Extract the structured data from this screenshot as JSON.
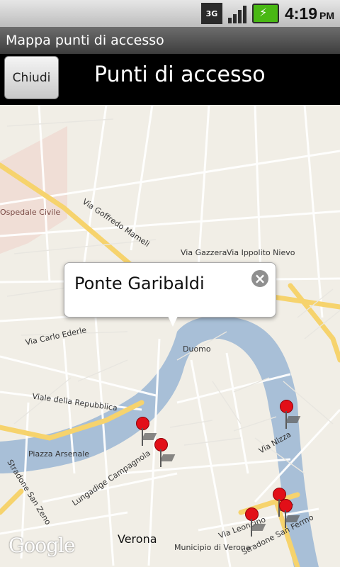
{
  "status": {
    "network": "3G",
    "time": "4:19",
    "ampm": "PM"
  },
  "app": {
    "title": "Mappa punti di accesso"
  },
  "topbar": {
    "close_label": "Chiudi",
    "title": "Punti di accesso"
  },
  "map": {
    "callout_title": "Ponte Garibaldi",
    "city_label": "Verona",
    "attribution": "Google",
    "labels": [
      "Via Goffredo Mameli",
      "Via Gazzera",
      "Via Ippolito Nievo",
      "Via Carlo Ederle",
      "Viale della Repubblica",
      "Piazza Arsenale",
      "Lungadige Campagnola",
      "Stradone San Zeno",
      "Stradone San Fermo",
      "Via Leoncino",
      "Duomo",
      "Municipio di Verona",
      "Ospedale Civile",
      "Via Nizza"
    ],
    "accent_color": "#e20f18"
  }
}
